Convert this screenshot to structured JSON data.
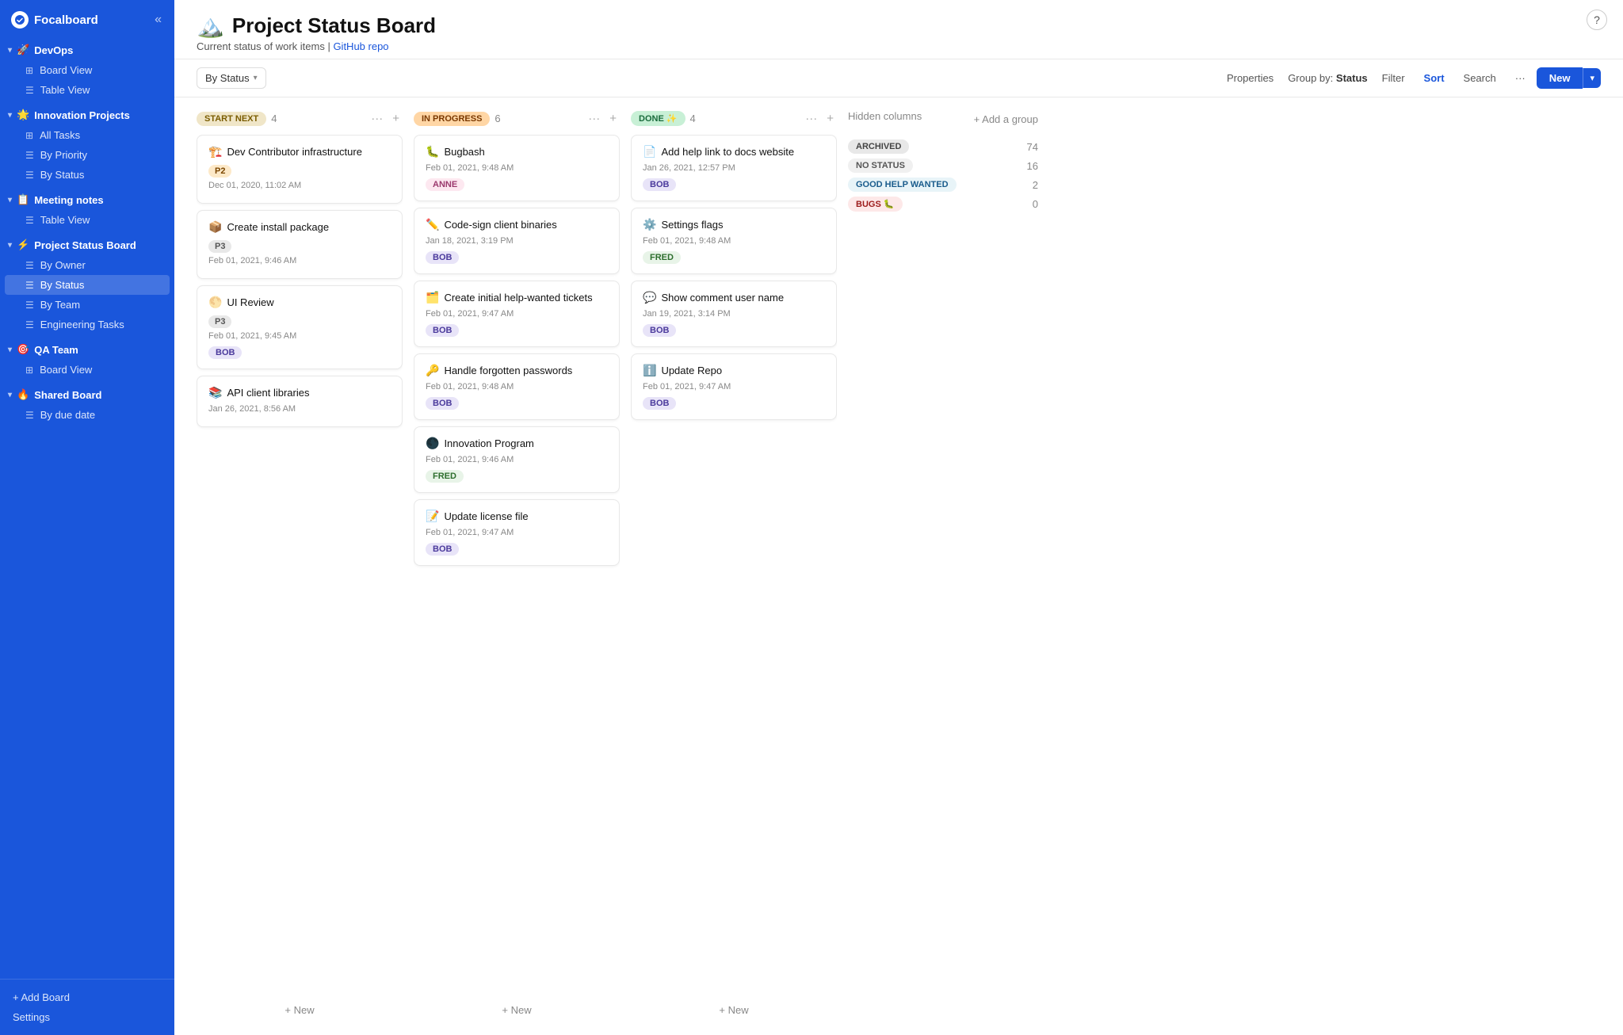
{
  "app": {
    "name": "Focalboard",
    "help_label": "?"
  },
  "sidebar": {
    "collapse_icon": "«",
    "groups": [
      {
        "id": "devops",
        "emoji": "🚀",
        "label": "DevOps",
        "items": [
          {
            "id": "board-view-devops",
            "icon": "⊞",
            "label": "Board View"
          },
          {
            "id": "table-view-devops",
            "icon": "☰",
            "label": "Table View"
          }
        ]
      },
      {
        "id": "innovation",
        "emoji": "🌟",
        "label": "Innovation Projects",
        "items": [
          {
            "id": "all-tasks",
            "icon": "⊞",
            "label": "All Tasks"
          },
          {
            "id": "by-priority",
            "icon": "☰",
            "label": "By Priority"
          },
          {
            "id": "by-status-innovation",
            "icon": "☰",
            "label": "By Status"
          }
        ]
      },
      {
        "id": "meeting",
        "emoji": "📋",
        "label": "Meeting notes",
        "items": [
          {
            "id": "table-view-meeting",
            "icon": "☰",
            "label": "Table View"
          }
        ]
      },
      {
        "id": "project-status",
        "emoji": "⚡",
        "label": "Project Status Board",
        "items": [
          {
            "id": "by-owner",
            "icon": "☰",
            "label": "By Owner"
          },
          {
            "id": "by-status-project",
            "icon": "☰",
            "label": "By Status",
            "active": true
          },
          {
            "id": "by-team",
            "icon": "☰",
            "label": "By Team"
          },
          {
            "id": "engineering-tasks",
            "icon": "☰",
            "label": "Engineering Tasks"
          }
        ]
      },
      {
        "id": "qa-team",
        "emoji": "🎯",
        "label": "QA Team",
        "items": [
          {
            "id": "board-view-qa",
            "icon": "⊞",
            "label": "Board View"
          }
        ]
      },
      {
        "id": "shared-board",
        "emoji": "🔥",
        "label": "Shared Board",
        "items": [
          {
            "id": "by-due-date",
            "icon": "☰",
            "label": "By due date"
          }
        ]
      }
    ],
    "add_board": "+ Add Board",
    "settings": "Settings"
  },
  "board": {
    "emoji": "🏔️",
    "title": "Project Status Board",
    "subtitle": "Current status of work items | ",
    "subtitle_link": "GitHub repo",
    "subtitle_link_url": "#"
  },
  "toolbar": {
    "view_label": "By Status",
    "properties_label": "Properties",
    "group_by_label": "Group by:",
    "group_by_value": "Status",
    "filter_label": "Filter",
    "sort_label": "Sort",
    "search_label": "Search",
    "more_label": "···",
    "new_label": "New",
    "new_arrow": "▾"
  },
  "columns": [
    {
      "id": "start-next",
      "badge": "START NEXT",
      "badge_class": "start-next",
      "count": 4,
      "cards": [
        {
          "id": "c1",
          "emoji": "🏗️",
          "title": "Dev Contributor infrastructure",
          "badge": "P2",
          "badge_class": "p2",
          "date": "Dec 01, 2020, 11:02 AM",
          "assignee": null
        },
        {
          "id": "c2",
          "emoji": "📦",
          "title": "Create install package",
          "badge": "P3",
          "badge_class": "p3",
          "date": "Feb 01, 2021, 9:46 AM",
          "assignee": null
        },
        {
          "id": "c3",
          "emoji": "🌕",
          "title": "UI Review",
          "badge": "P3",
          "badge_class": "p3",
          "date": "Feb 01, 2021, 9:45 AM",
          "assignee": "BOB"
        },
        {
          "id": "c4",
          "emoji": "📚",
          "title": "API client libraries",
          "badge": null,
          "date": "Jan 26, 2021, 8:56 AM",
          "assignee": null
        }
      ],
      "add_label": "+ New"
    },
    {
      "id": "in-progress",
      "badge": "IN PROGRESS",
      "badge_class": "in-progress",
      "count": 6,
      "cards": [
        {
          "id": "c5",
          "emoji": "🐛",
          "title": "Bugbash",
          "badge": null,
          "date": "Feb 01, 2021, 9:48 AM",
          "assignee": "ANNE",
          "assignee_class": "anne"
        },
        {
          "id": "c6",
          "emoji": "✏️",
          "title": "Code-sign client binaries",
          "badge": null,
          "date": "Jan 18, 2021, 3:19 PM",
          "assignee": "BOB"
        },
        {
          "id": "c7",
          "emoji": "🗂️",
          "title": "Create initial help-wanted tickets",
          "badge": null,
          "date": "Feb 01, 2021, 9:47 AM",
          "assignee": "BOB"
        },
        {
          "id": "c8",
          "emoji": "🔑",
          "title": "Handle forgotten passwords",
          "badge": null,
          "date": "Feb 01, 2021, 9:48 AM",
          "assignee": "BOB"
        },
        {
          "id": "c9",
          "emoji": "🌑",
          "title": "Innovation Program",
          "badge": null,
          "date": "Feb 01, 2021, 9:46 AM",
          "assignee": "FRED",
          "assignee_class": "fred"
        },
        {
          "id": "c10",
          "emoji": "📝",
          "title": "Update license file",
          "badge": null,
          "date": "Feb 01, 2021, 9:47 AM",
          "assignee": "BOB"
        }
      ],
      "add_label": "+ New"
    },
    {
      "id": "done",
      "badge": "DONE ✨",
      "badge_class": "done",
      "count": 4,
      "cards": [
        {
          "id": "c11",
          "emoji": "📄",
          "title": "Add help link to docs website",
          "badge": null,
          "date": "Jan 26, 2021, 12:57 PM",
          "assignee": "BOB"
        },
        {
          "id": "c12",
          "emoji": "⚙️",
          "title": "Settings flags",
          "badge": null,
          "date": "Feb 01, 2021, 9:48 AM",
          "assignee": "FRED",
          "assignee_class": "fred"
        },
        {
          "id": "c13",
          "emoji": "💬",
          "title": "Show comment user name",
          "badge": null,
          "date": "Jan 19, 2021, 3:14 PM",
          "assignee": "BOB"
        },
        {
          "id": "c14",
          "emoji": "ℹ️",
          "title": "Update Repo",
          "badge": null,
          "date": "Feb 01, 2021, 9:47 AM",
          "assignee": "BOB"
        }
      ],
      "add_label": "+ New"
    }
  ],
  "hidden_columns": {
    "header": "Hidden columns",
    "add_group": "+ Add a group",
    "items": [
      {
        "id": "archived",
        "label": "ARCHIVED",
        "badge_class": "archived",
        "count": 74
      },
      {
        "id": "no-status",
        "label": "NO STATUS",
        "badge_class": "no-status",
        "count": 16
      },
      {
        "id": "good-help",
        "label": "GOOD HELP WANTED",
        "badge_class": "good-help",
        "count": 2
      },
      {
        "id": "bugs",
        "label": "BUGS 🐛",
        "badge_class": "bugs",
        "count": 0
      }
    ]
  }
}
